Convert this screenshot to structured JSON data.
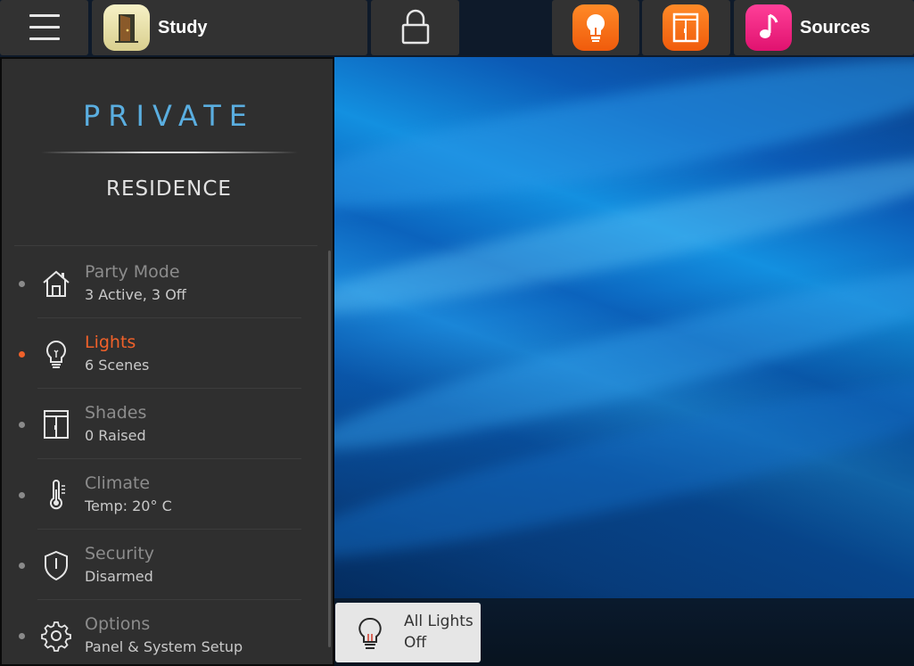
{
  "topbar": {
    "menu_icon": "hamburger-menu-icon",
    "room": {
      "icon": "door-icon",
      "label": "Study"
    },
    "lock_icon": "padlock-icon",
    "lights_icon": "lightbulb-icon",
    "shades_icon": "shades-icon",
    "sources": {
      "icon": "music-note-icon",
      "label": "Sources"
    }
  },
  "sidebar": {
    "brand_title": "PRIVATE",
    "brand_subtitle": "RESIDENCE",
    "items": [
      {
        "title": "Party Mode",
        "subtitle": "3 Active, 3 Off",
        "icon": "house-icon",
        "active": false
      },
      {
        "title": "Lights",
        "subtitle": "6 Scenes",
        "icon": "lightbulb-icon",
        "active": true
      },
      {
        "title": "Shades",
        "subtitle": "0 Raised",
        "icon": "shades-icon",
        "active": false
      },
      {
        "title": "Climate",
        "subtitle": "Temp: 20° C",
        "icon": "thermometer-icon",
        "active": false
      },
      {
        "title": "Security",
        "subtitle": "Disarmed",
        "icon": "shield-icon",
        "active": false
      },
      {
        "title": "Options",
        "subtitle": "Panel & System Setup",
        "icon": "gear-icon",
        "active": false
      }
    ]
  },
  "dock": {
    "all_lights": {
      "title": "All Lights",
      "status": "Off",
      "icon": "lightbulb-icon"
    }
  },
  "colors": {
    "accent_active": "#f0612a",
    "brand_blue": "#5aaee0",
    "lights_tile": "#f26a18",
    "sources_tile": "#f0247f",
    "room_tile": "#efe7b0"
  }
}
